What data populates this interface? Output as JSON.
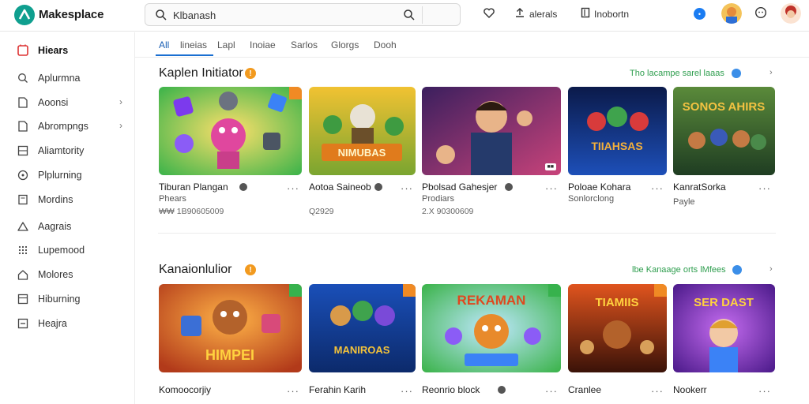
{
  "header": {
    "app_title": "Makesplace",
    "search_value": "Klbanash",
    "action1_label": "alerals",
    "action2_label": "Inobortn",
    "notify_count": "•"
  },
  "sidebar": {
    "items": [
      {
        "label": "Hiears",
        "icon": "store-icon",
        "chevron": false,
        "active": true
      },
      {
        "label": "Aplurmna",
        "icon": "search-icon",
        "chevron": false
      },
      {
        "label": "Aoonsi",
        "icon": "document-icon",
        "chevron": true
      },
      {
        "label": "Abrompngs",
        "icon": "document-icon",
        "chevron": true
      },
      {
        "label": "Aliamtority",
        "icon": "grid-icon",
        "chevron": false
      },
      {
        "label": "Plplurning",
        "icon": "circle-icon",
        "chevron": false
      },
      {
        "label": "Mordins",
        "icon": "file-icon",
        "chevron": false
      },
      {
        "label": "Aagrais",
        "icon": "send-icon",
        "chevron": false
      },
      {
        "label": "Lupemood",
        "icon": "dots-grid-icon",
        "chevron": false
      },
      {
        "label": "Molores",
        "icon": "home-icon",
        "chevron": false
      },
      {
        "label": "Hiburning",
        "icon": "monitor-icon",
        "chevron": false
      },
      {
        "label": "Heajra",
        "icon": "minus-box-icon",
        "chevron": false
      }
    ]
  },
  "tabs": [
    "All",
    "lineias",
    "Lapl",
    "Inoiae",
    "Sarlos",
    "Glorgs",
    "Dooh"
  ],
  "sections": [
    {
      "title": "Kaplen Initiator",
      "link_label": "Tho lacampe sarel laaas",
      "cards": [
        {
          "title": "Tiburan Plangan",
          "sub": "Phears",
          "price": "₩₩ 1B90605009",
          "verified": true
        },
        {
          "title": "Aotoa Saineob",
          "sub": "",
          "price": "Q2929",
          "verified": true,
          "img_text": "NIMUBAS"
        },
        {
          "title": "Pbolsad Gahesjer",
          "sub": "Prodiars",
          "price": "2.X 90300609",
          "verified": true
        },
        {
          "title": "Poloae Kohara",
          "sub": "Sonlorclong",
          "price": "",
          "verified": false,
          "img_text": "TIIAHSAS"
        },
        {
          "title": "KanratSorka",
          "sub": "Payle",
          "price": "",
          "verified": false,
          "img_text": "SONOS AHIRS"
        }
      ]
    },
    {
      "title": "Kanaionlulior",
      "link_label": "lbe Kanaage orts lMfees",
      "cards": [
        {
          "title": "Komoocorjiy",
          "verified": false,
          "img_text": "HIMPEI"
        },
        {
          "title": "Ferahin Karih",
          "verified": false,
          "img_text": "MANIROAS"
        },
        {
          "title": "Reonrio block",
          "verified": true,
          "img_text": "REKAMAN"
        },
        {
          "title": "Cranlee",
          "verified": false,
          "img_text": "TIAMIIS"
        },
        {
          "title": "Nookerr",
          "verified": false,
          "img_text": "SER DAST"
        }
      ]
    }
  ]
}
